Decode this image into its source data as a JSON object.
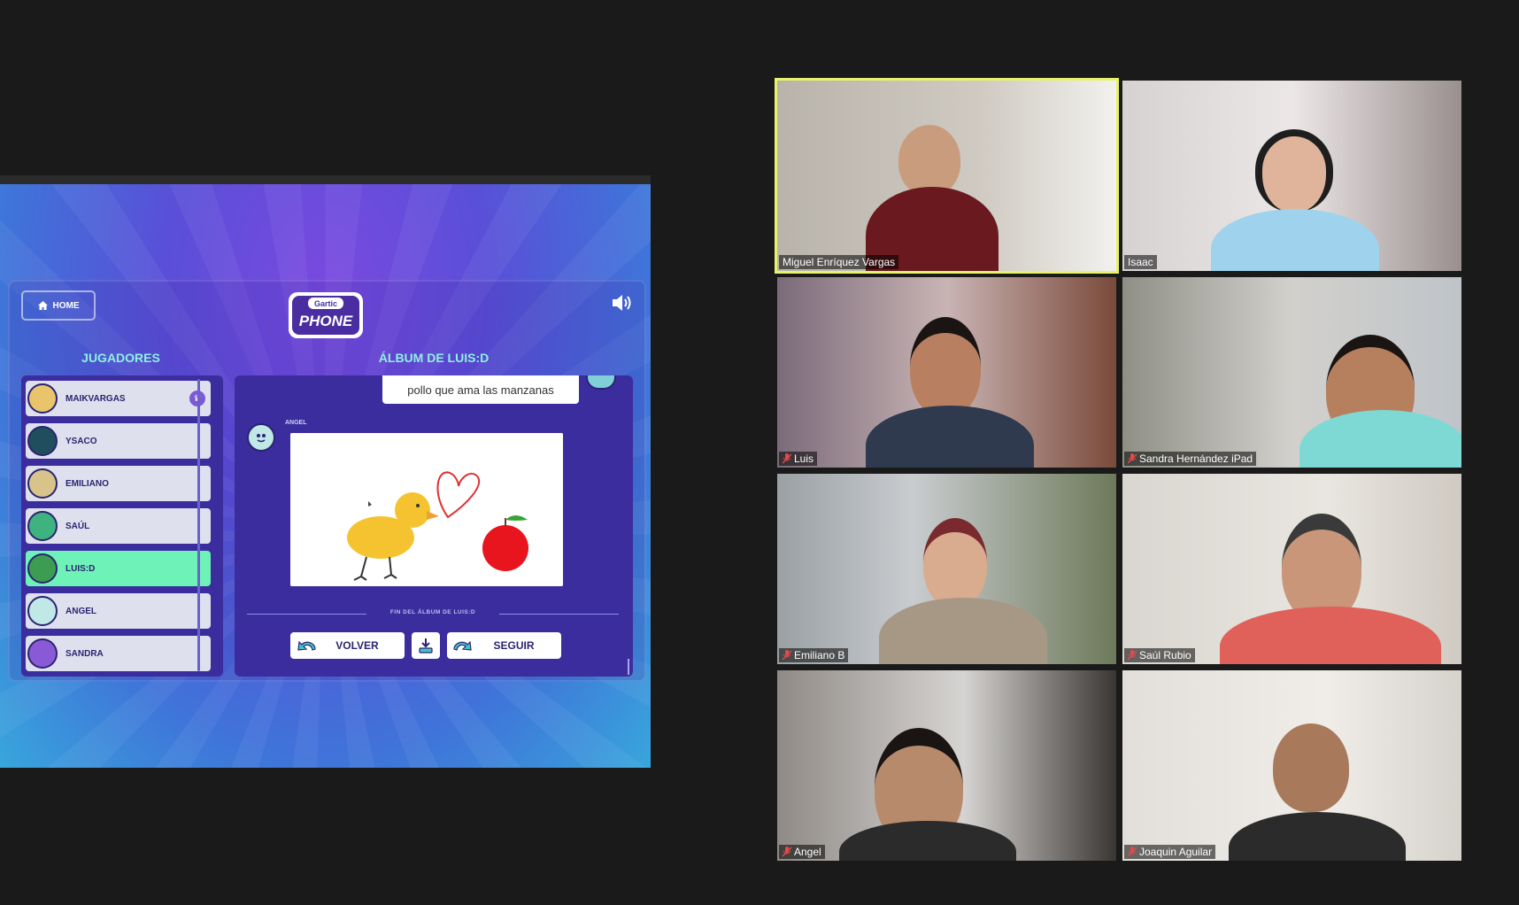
{
  "shared_screen": {
    "home_label": "HOME",
    "logo_top": "Gartic",
    "logo_main": "PHONE",
    "players_heading": "JUGADORES",
    "album_heading": "ÁLBUM DE LUIS:D",
    "players": [
      {
        "name": "MAIKVARGAS",
        "host": true,
        "active": false,
        "avatar_color": "#e9c46a"
      },
      {
        "name": "YSACO",
        "host": false,
        "active": false,
        "avatar_color": "#1f4e5f"
      },
      {
        "name": "EMILIANO",
        "host": false,
        "active": false,
        "avatar_color": "#d8c38a"
      },
      {
        "name": "SAÚL",
        "host": false,
        "active": false,
        "avatar_color": "#3fb37f"
      },
      {
        "name": "LUIS:D",
        "host": false,
        "active": true,
        "avatar_color": "#3c9d52"
      },
      {
        "name": "ANGEL",
        "host": false,
        "active": false,
        "avatar_color": "#bfe8e6"
      },
      {
        "name": "SANDRA",
        "host": false,
        "active": false,
        "avatar_color": "#8a5ad6"
      }
    ],
    "album": {
      "previous_text": "pollo que ama las manzanas",
      "drawing_author": "ANGEL",
      "end_text": "FIN DEL ÁLBUM DE LUIS:D",
      "back_label": "VOLVER",
      "next_label": "SEGUIR"
    }
  },
  "participants": [
    {
      "name": "Miguel Enríquez Vargas",
      "muted": false,
      "speaking": true
    },
    {
      "name": "Isaac",
      "muted": false,
      "speaking": false
    },
    {
      "name": "Luis",
      "muted": true,
      "speaking": false
    },
    {
      "name": "Sandra Hernández iPad",
      "muted": true,
      "speaking": false
    },
    {
      "name": "Emiliano B",
      "muted": true,
      "speaking": false
    },
    {
      "name": "Saúl Rubio",
      "muted": true,
      "speaking": false
    },
    {
      "name": "Angel",
      "muted": true,
      "speaking": false
    },
    {
      "name": "Joaquin Aguilar",
      "muted": true,
      "speaking": false
    }
  ]
}
